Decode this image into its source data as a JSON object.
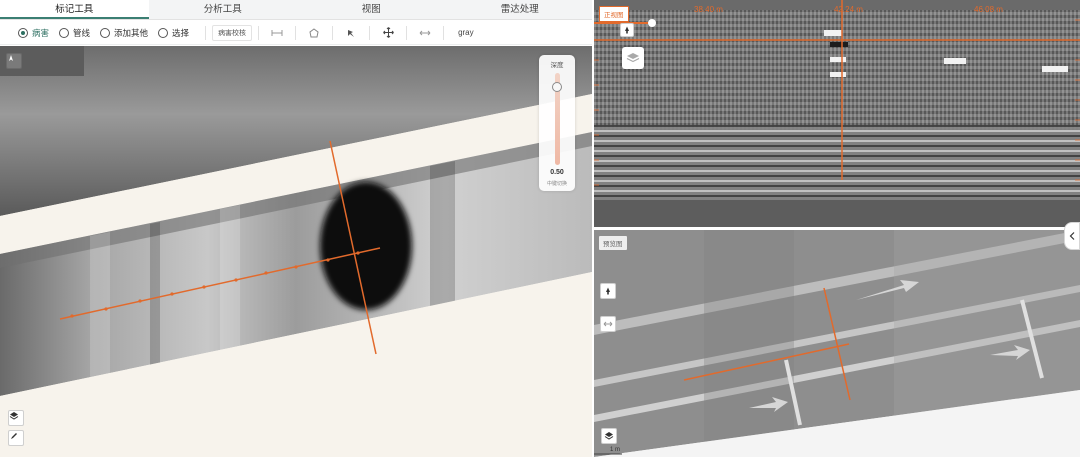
{
  "tabs": [
    {
      "label": "标记工具",
      "active": true
    },
    {
      "label": "分析工具",
      "active": false
    },
    {
      "label": "视图",
      "active": false
    },
    {
      "label": "雷达处理",
      "active": false
    }
  ],
  "toolbar": {
    "radios": [
      {
        "label": "病害",
        "checked": true
      },
      {
        "label": "管线",
        "checked": false
      },
      {
        "label": "添加其他",
        "checked": false
      },
      {
        "label": "选择",
        "checked": false
      }
    ],
    "check_button": "病害校核",
    "icons": [
      "measure-line-icon",
      "polygon-icon",
      "pin-icon",
      "move-icon",
      "double-arrow-icon"
    ],
    "color_mode": "gray"
  },
  "depth_panel": {
    "title": "深度",
    "value": "0.50",
    "value_fraction": 0.1,
    "subtitle": "中键切换"
  },
  "radar": {
    "tag": "正视图",
    "distances": [
      "38.40 m",
      "42.24 m",
      "46.08 m"
    ]
  },
  "plan": {
    "tag": "预览图",
    "scale": "1 m"
  },
  "colors": {
    "accent": "#e26a2c",
    "active_tab": "#3b7f73",
    "radio_checked": "#2d6f61"
  }
}
